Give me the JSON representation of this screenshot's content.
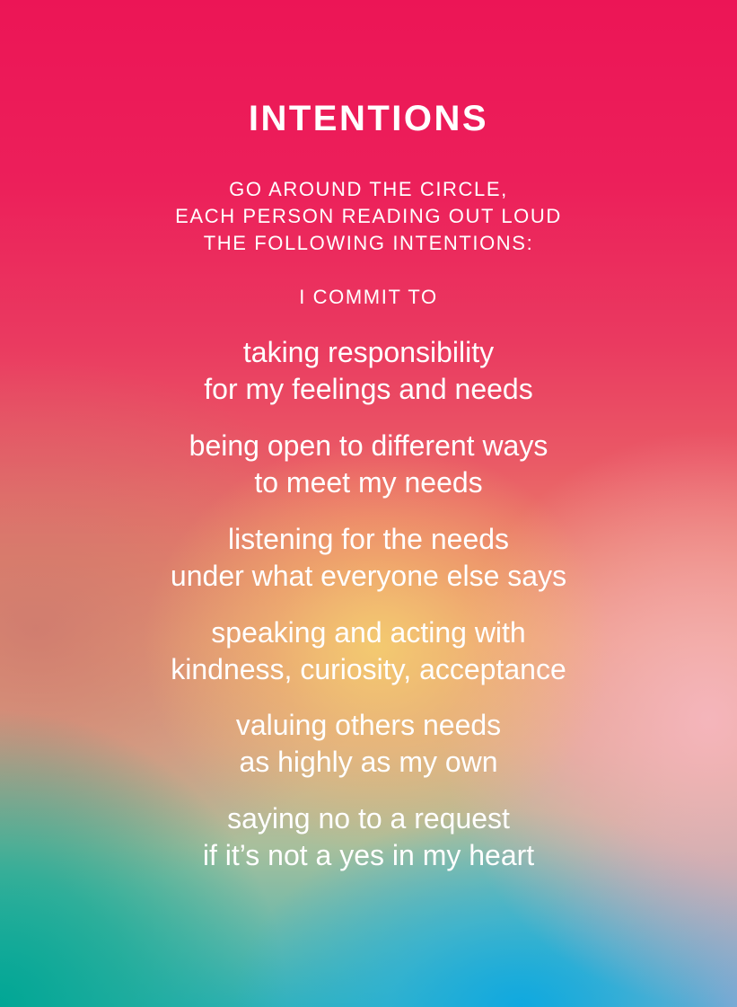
{
  "card": {
    "title": "INTENTIONS",
    "instructions": [
      "GO AROUND THE CIRCLE,",
      "EACH PERSON READING OUT LOUD",
      "THE FOLLOWING INTENTIONS:"
    ],
    "commit_heading": "I COMMIT TO",
    "intentions": [
      {
        "line1": "taking responsibility",
        "line2": "for my feelings and needs"
      },
      {
        "line1": "being open to different ways",
        "line2": "to meet my needs"
      },
      {
        "line1": "listening for the needs",
        "line2": "under what everyone else says"
      },
      {
        "line1": "speaking and acting with",
        "line2": "kindness, curiosity, acceptance"
      },
      {
        "line1": "valuing others needs",
        "line2": "as highly as my own"
      },
      {
        "line1": "saying no to a request",
        "line2": "if it’s not a yes in my heart"
      }
    ]
  },
  "colors": {
    "text": "#ffffff",
    "top_pink": "#ec1556",
    "warm_center": "#f4cc70",
    "light_pink": "#f6b6be",
    "teal": "#00a694",
    "sky_blue": "#0ea8e2",
    "lavender": "#a0a6d2"
  }
}
